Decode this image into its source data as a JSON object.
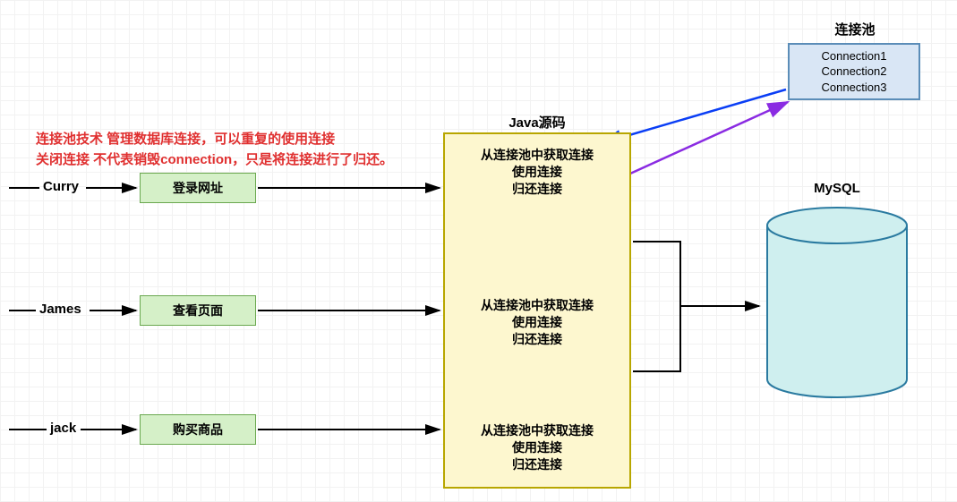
{
  "titles": {
    "pool": "连接池",
    "java": "Java源码",
    "mysql": "MySQL"
  },
  "pool_box": {
    "line1": "Connection1",
    "line2": "Connection2",
    "line3": "Connection3"
  },
  "red_note": {
    "line1": "连接池技术 管理数据库连接，可以重复的使用连接",
    "line2": "关闭连接 不代表销毁connection，只是将连接进行了归还。"
  },
  "users": {
    "u1": "Curry",
    "u2": "James",
    "u3": "jack"
  },
  "actions": {
    "a1": "登录网址",
    "a2": "查看页面",
    "a3": "购买商品"
  },
  "java_block": {
    "line_get": "从连接池中获取连接",
    "line_use": "使用连接",
    "line_return": "归还连接"
  },
  "chart_data": {
    "type": "diagram",
    "description": "Connection pool architecture. Three users trigger three actions → Java源码 block performs (获取连接 从连接池 → 使用连接 → 归还连接) for each → communicates with MySQL. Pool box holds Connection1/2/3. Blue arrow: pool → Java (obtain). Purple arrow: Java → pool (return).",
    "flows": [
      {
        "user": "Curry",
        "action": "登录网址"
      },
      {
        "user": "James",
        "action": "查看页面"
      },
      {
        "user": "jack",
        "action": "购买商品"
      }
    ],
    "java_steps": [
      "从连接池中获取连接",
      "使用连接",
      "归还连接"
    ],
    "pool_connections": [
      "Connection1",
      "Connection2",
      "Connection3"
    ],
    "arrows": [
      {
        "from": "连接池",
        "to": "Java源码",
        "color": "#0a3ef5",
        "meaning": "获取连接"
      },
      {
        "from": "Java源码",
        "to": "连接池",
        "color": "#8a2be2",
        "meaning": "归还连接"
      }
    ],
    "db": "MySQL",
    "note_color": "#e03030"
  }
}
